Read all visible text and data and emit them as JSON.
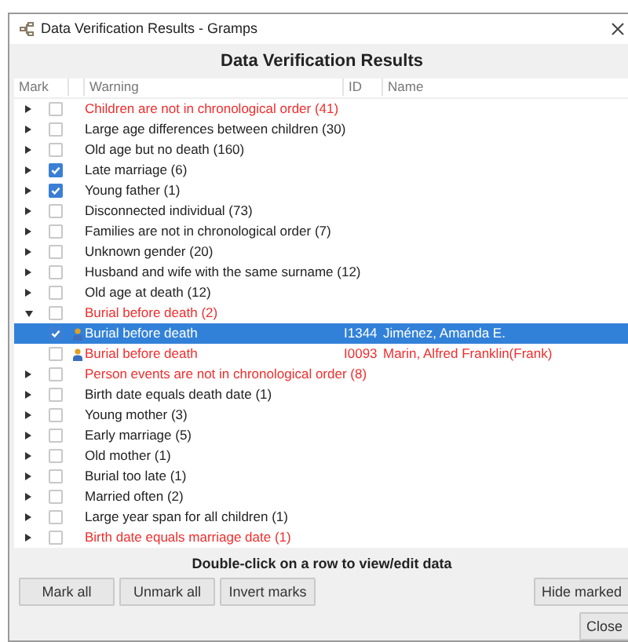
{
  "window": {
    "title": "Data Verification Results - Gramps"
  },
  "heading": "Data Verification Results",
  "columns": [
    "Mark",
    "Warning",
    "ID",
    "Name"
  ],
  "rows": [
    {
      "warning": "Children are not in chronological order (41)",
      "error": true,
      "checked": false,
      "expanded": false
    },
    {
      "warning": "Large age differences between children (30)",
      "error": false,
      "checked": false,
      "expanded": false
    },
    {
      "warning": "Old age but no death (160)",
      "error": false,
      "checked": false,
      "expanded": false
    },
    {
      "warning": "Late marriage (6)",
      "error": false,
      "checked": true,
      "expanded": false
    },
    {
      "warning": "Young father (1)",
      "error": false,
      "checked": true,
      "expanded": false
    },
    {
      "warning": "Disconnected individual (73)",
      "error": false,
      "checked": false,
      "expanded": false
    },
    {
      "warning": "Families are not in chronological order (7)",
      "error": false,
      "checked": false,
      "expanded": false
    },
    {
      "warning": "Unknown gender (20)",
      "error": false,
      "checked": false,
      "expanded": false
    },
    {
      "warning": "Husband and wife with the same surname (12)",
      "error": false,
      "checked": false,
      "expanded": false
    },
    {
      "warning": "Old age at death (12)",
      "error": false,
      "checked": false,
      "expanded": false
    },
    {
      "warning": "Burial before death (2)",
      "error": true,
      "checked": false,
      "expanded": true,
      "children": [
        {
          "warning": "Burial before death",
          "id": "I1344",
          "name": "Jiménez, Amanda E.",
          "error": true,
          "checked": true,
          "selected": true
        },
        {
          "warning": "Burial before death",
          "id": "I0093",
          "name": "Marin, Alfred Franklin(Frank)",
          "error": true,
          "checked": false,
          "selected": false
        }
      ]
    },
    {
      "warning": "Person events are not in chronological order (8)",
      "error": true,
      "checked": false,
      "expanded": false
    },
    {
      "warning": "Birth date equals death date (1)",
      "error": false,
      "checked": false,
      "expanded": false
    },
    {
      "warning": "Young mother (3)",
      "error": false,
      "checked": false,
      "expanded": false
    },
    {
      "warning": "Early marriage (5)",
      "error": false,
      "checked": false,
      "expanded": false
    },
    {
      "warning": "Old mother (1)",
      "error": false,
      "checked": false,
      "expanded": false
    },
    {
      "warning": "Burial too late (1)",
      "error": false,
      "checked": false,
      "expanded": false
    },
    {
      "warning": "Married often (2)",
      "error": false,
      "checked": false,
      "expanded": false
    },
    {
      "warning": "Large year span for all children (1)",
      "error": false,
      "checked": false,
      "expanded": false
    },
    {
      "warning": "Birth date equals marriage date (1)",
      "error": true,
      "checked": false,
      "expanded": false
    }
  ],
  "hint": "Double-click on a row to view/edit data",
  "buttons": [
    "Mark all",
    "Unmark all",
    "Invert marks"
  ],
  "right_button": "Hide marked",
  "close_button": "Close"
}
